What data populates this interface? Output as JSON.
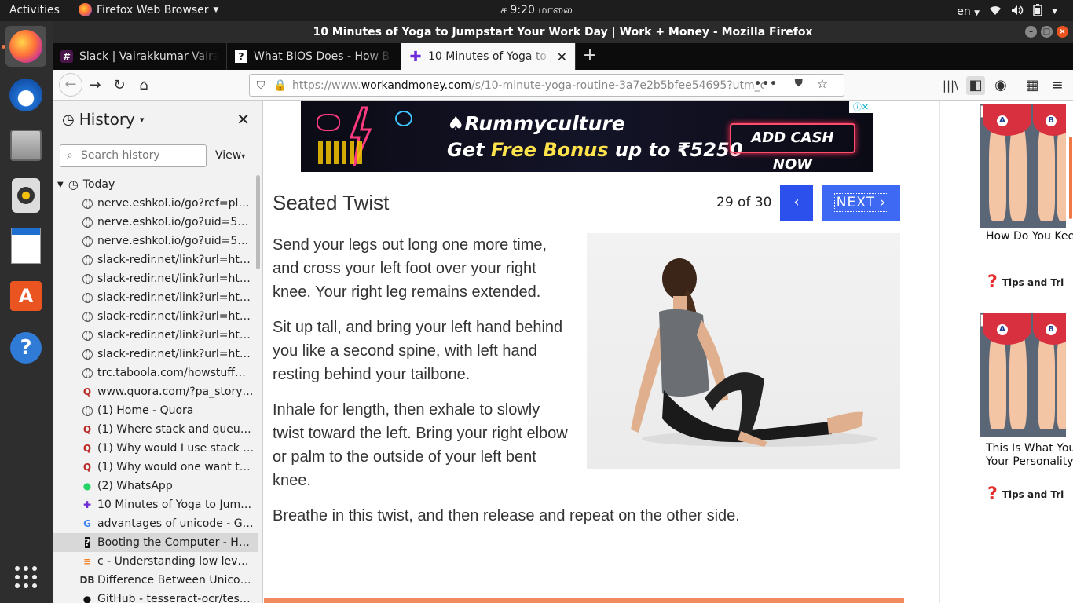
{
  "topbar": {
    "activities": "Activities",
    "app_name": "Firefox Web Browser",
    "clock": "ச  9:20 மாலை",
    "lang": "en"
  },
  "window": {
    "title": "10 Minutes of Yoga to Jumpstart Your Work Day | Work + Money - Mozilla Firefox"
  },
  "tabs": [
    {
      "label": "Slack | Vairakkumar Vaira",
      "icon": "slack-icon"
    },
    {
      "label": "What BIOS Does - How B",
      "icon": "howstuffworks-icon"
    },
    {
      "label": "10 Minutes of Yoga to Ju",
      "icon": "workandmoney-icon"
    }
  ],
  "url": {
    "scheme": "https://www.",
    "domain": "workandmoney.com",
    "path": "/s/10-minute-yoga-routine-3a7e2b5bfee54695?utm_c"
  },
  "sidebar": {
    "title": "History",
    "search_placeholder": "Search history",
    "view_label": "View",
    "group_label": "Today",
    "items": [
      {
        "label": "nerve.eshkol.io/go?ref=pl&h...",
        "icon": "globe"
      },
      {
        "label": "nerve.eshkol.io/go?uid=5e1...",
        "icon": "globe"
      },
      {
        "label": "nerve.eshkol.io/go?uid=5e1...",
        "icon": "globe"
      },
      {
        "label": "slack-redir.net/link?url=http...",
        "icon": "globe"
      },
      {
        "label": "slack-redir.net/link?url=http...",
        "icon": "globe"
      },
      {
        "label": "slack-redir.net/link?url=http...",
        "icon": "globe"
      },
      {
        "label": "slack-redir.net/link?url=http...",
        "icon": "globe"
      },
      {
        "label": "slack-redir.net/link?url=http...",
        "icon": "globe"
      },
      {
        "label": "slack-redir.net/link?url=http...",
        "icon": "globe"
      },
      {
        "label": "trc.taboola.com/howstuffwo...",
        "icon": "globe"
      },
      {
        "label": "www.quora.com/?pa_story=...",
        "icon": "quora"
      },
      {
        "label": "(1) Home - Quora",
        "icon": "globe"
      },
      {
        "label": "(1) Where stack and queue u...",
        "icon": "quora"
      },
      {
        "label": "(1) Why would I use stack ins...",
        "icon": "quora"
      },
      {
        "label": "(1) Why would one want to u...",
        "icon": "quora"
      },
      {
        "label": "(2) WhatsApp",
        "icon": "whatsapp"
      },
      {
        "label": "10 Minutes of Yoga to Jump...",
        "icon": "plus"
      },
      {
        "label": "advantages of unicode - Goo...",
        "icon": "google"
      },
      {
        "label": "Booting the Computer - How...",
        "icon": "hsw"
      },
      {
        "label": "c - Understanding low level f...",
        "icon": "stackoverflow"
      },
      {
        "label": "Difference Between Unicod...",
        "icon": "db"
      },
      {
        "label": "GitHub - tesseract-ocr/tessd...",
        "icon": "github"
      }
    ]
  },
  "ad_banner": {
    "brand": "Rummyculture",
    "offer_pre": "Get ",
    "offer_hl": "Free Bonus",
    "offer_post": " up to ₹5250",
    "cta": "ADD CASH NOW"
  },
  "article": {
    "title": "Seated Twist",
    "pager": "29 of 30",
    "prev": "‹",
    "next": "NEXT ›",
    "paragraphs": [
      "Send your legs out long one more time, and cross your left foot over your right knee. Your right leg remains extended.",
      "Sit up tall, and bring your left hand behind you like a second spine, with left hand resting behind your tailbone.",
      "Inhale for length, then exhale to slowly twist toward the left. Bring your right elbow or palm to the outside of your left bent knee."
    ],
    "last_paragraph": "Breathe in this twist, and then release and repeat on the other side."
  },
  "side_ads": [
    {
      "ad": "Ad",
      "a": "A",
      "b": "B",
      "caption": "How Do You Kee",
      "tips": "Tips and Tri"
    },
    {
      "ad": "Ad",
      "a": "A",
      "b": "B",
      "caption": "This Is What You\nYour Personality",
      "tips": "Tips and Tri"
    }
  ]
}
